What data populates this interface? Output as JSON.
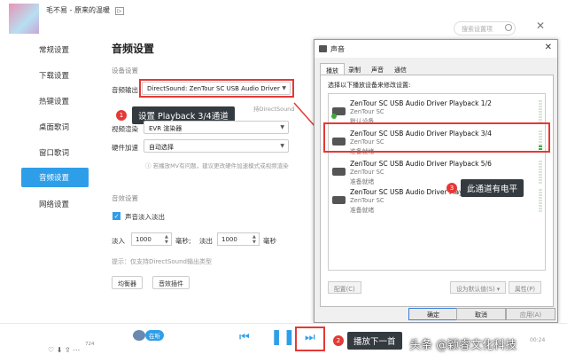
{
  "top": {
    "search_placeholder": "搜索设置项"
  },
  "nav": {
    "items": [
      {
        "label": "常规设置"
      },
      {
        "label": "下载设置"
      },
      {
        "label": "热键设置"
      },
      {
        "label": "桌面歌词"
      },
      {
        "label": "窗口歌词"
      },
      {
        "label": "音频设置"
      },
      {
        "label": "网络设置"
      }
    ],
    "active_index": 5
  },
  "settings": {
    "title": "音频设置",
    "section_device": "设备设置",
    "output_label": "音频输出",
    "output_value": "DirectSound: ZenTour SC USB Audio Driver",
    "video_label": "视频渲染",
    "video_value": "EVR 渲染器",
    "hw_label": "硬件加速",
    "hw_value": "自动选择",
    "hint_mv": "若播放MV有问题，建议更改硬件加速模式或视频渲染",
    "hint_ds_trail": "持DirectSound",
    "section_effects": "音效设置",
    "fade_label": "声音淡入淡出",
    "fade_in_label": "淡入",
    "fade_in_value": "1000",
    "ms_unit": "毫秒;",
    "fade_out_label": "淡出",
    "fade_out_value": "1000",
    "ms_unit_end": "毫秒",
    "tip": "提示：仅支持DirectSound输出类型",
    "eq_button": "均衡器",
    "plugins_button": "音效插件"
  },
  "annotations": {
    "n1": "1",
    "label1": "设置 Playback 3/4通道",
    "n2": "2",
    "label2": "播放下一首",
    "n3": "3",
    "label3": "此通道有电平"
  },
  "dialog": {
    "title": "声音",
    "close": "✕",
    "tabs": [
      {
        "label": "播放"
      },
      {
        "label": "录制"
      },
      {
        "label": "声音"
      },
      {
        "label": "通信"
      }
    ],
    "caption": "选择以下播放设备来修改设置:",
    "devices": [
      {
        "name": "ZenTour SC USB Audio Driver Playback 1/2",
        "vendor": "ZenTour SC",
        "status": "默认设备",
        "level": 0
      },
      {
        "name": "ZenTour SC USB Audio Driver Playback 3/4",
        "vendor": "ZenTour SC",
        "status": "准备就绪",
        "level": 0.35
      },
      {
        "name": "ZenTour SC USB Audio Driver Playback 5/6",
        "vendor": "ZenTour SC",
        "status": "准备就绪",
        "level": 0
      },
      {
        "name": "ZenTour SC USB Audio Driver Playback 7/8",
        "vendor": "ZenTour SC",
        "status": "准备就绪",
        "level": 0
      }
    ],
    "configure": "配置(C)",
    "set_default": "设为默认值(S)",
    "properties": "属性(P)",
    "ok": "确定",
    "cancel": "取消",
    "apply": "应用(A)"
  },
  "player": {
    "song": "毛不易 - 原来的温暖",
    "listening": "在听",
    "count": "724",
    "time_hint": "00:24"
  },
  "watermark": "头条 @颖睿文化科技",
  "colors": {
    "accent": "#2f9ee9",
    "annotation_red": "#e53935"
  }
}
